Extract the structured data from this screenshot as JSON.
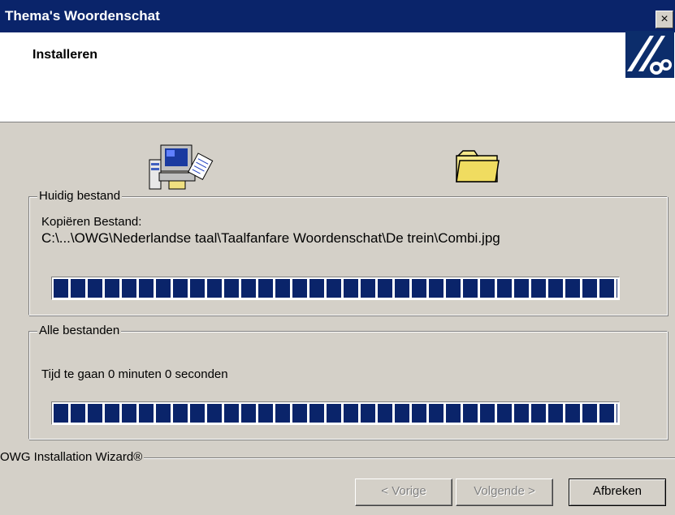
{
  "window": {
    "title": "Thema's Woordenschat",
    "close_label": "×"
  },
  "header": {
    "title": "Installeren"
  },
  "current_file": {
    "legend": "Huidig bestand",
    "action": "Kopiëren Bestand:",
    "path": "C:\\...\\OWG\\Nederlandse taal\\Taalfanfare Woordenschat\\De trein\\Combi.jpg",
    "progress": 1.0
  },
  "all_files": {
    "legend": "Alle bestanden",
    "remaining": "Tijd te gaan 0 minuten 0 seconden",
    "progress": 1.0
  },
  "footer": {
    "brand": "OWG Installation Wizard®"
  },
  "buttons": {
    "prev": "< Vorige",
    "next": "Volgende >",
    "cancel": "Afbreken"
  },
  "icons": {
    "computer": "computer-copy-icon",
    "folder": "folder-icon",
    "logo": "owg-logo-icon"
  },
  "colors": {
    "title_bar": "#0a246a",
    "progress": "#0a246a",
    "background": "#d4d0c8"
  }
}
